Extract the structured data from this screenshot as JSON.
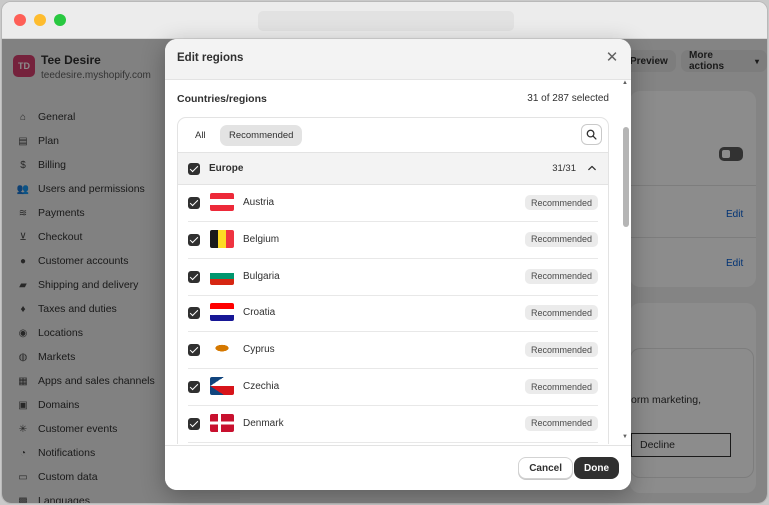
{
  "store": {
    "initials": "TD",
    "name": "Tee Desire",
    "url": "teedesire.myshopify.com"
  },
  "nav": [
    {
      "label": "General",
      "icon": "store-icon"
    },
    {
      "label": "Plan",
      "icon": "plan-icon"
    },
    {
      "label": "Billing",
      "icon": "billing-icon"
    },
    {
      "label": "Users and permissions",
      "icon": "users-icon"
    },
    {
      "label": "Payments",
      "icon": "payments-icon"
    },
    {
      "label": "Checkout",
      "icon": "cart-icon"
    },
    {
      "label": "Customer accounts",
      "icon": "person-icon"
    },
    {
      "label": "Shipping and delivery",
      "icon": "truck-icon"
    },
    {
      "label": "Taxes and duties",
      "icon": "tax-icon"
    },
    {
      "label": "Locations",
      "icon": "location-icon"
    },
    {
      "label": "Markets",
      "icon": "globe-icon"
    },
    {
      "label": "Apps and sales channels",
      "icon": "apps-icon"
    },
    {
      "label": "Domains",
      "icon": "domain-icon"
    },
    {
      "label": "Customer events",
      "icon": "events-icon"
    },
    {
      "label": "Notifications",
      "icon": "bell-icon"
    },
    {
      "label": "Custom data",
      "icon": "data-icon"
    },
    {
      "label": "Languages",
      "icon": "language-icon"
    }
  ],
  "background": {
    "preview_label": "Preview",
    "more_actions_label": "More actions",
    "edit_1": "Edit",
    "edit_2": "Edit",
    "marketing_text": "orm marketing,",
    "decline_label": "Decline"
  },
  "modal": {
    "title": "Edit regions",
    "section_title": "Countries/regions",
    "selected_count": "31 of 287 selected",
    "tabs": {
      "all": "All",
      "recommended": "Recommended"
    },
    "group": {
      "label": "Europe",
      "count": "31/31"
    },
    "countries": [
      {
        "name": "Austria",
        "badge": "Recommended"
      },
      {
        "name": "Belgium",
        "badge": "Recommended"
      },
      {
        "name": "Bulgaria",
        "badge": "Recommended"
      },
      {
        "name": "Croatia",
        "badge": "Recommended"
      },
      {
        "name": "Cyprus",
        "badge": "Recommended"
      },
      {
        "name": "Czechia",
        "badge": "Recommended"
      },
      {
        "name": "Denmark",
        "badge": "Recommended"
      }
    ],
    "cancel_label": "Cancel",
    "done_label": "Done"
  },
  "colors": {
    "accent": "#303030",
    "link": "#005bd3",
    "avatar": "#d63f6d"
  }
}
